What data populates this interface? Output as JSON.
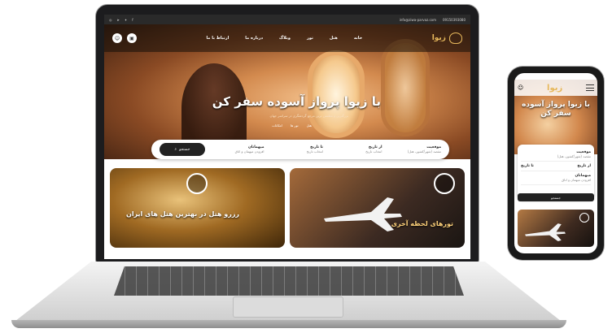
{
  "laptop": {
    "topbar": {
      "social_icons": [
        "instagram-icon",
        "telegram-icon",
        "twitter-icon",
        "facebook-icon"
      ],
      "email": "info@ziwa-parvaz.com",
      "phone": "09150393080"
    },
    "nav": {
      "logo_text": "زیوا",
      "menu": [
        "خانه",
        "هتل",
        "تور",
        "وبلاگ",
        "درباره ما",
        "ارتباط با ما"
      ]
    },
    "hero": {
      "title": "با زیوا پرواز آسوده سفر کن",
      "subtitle": "بزرگترین و مطمئن ترین مرجع گردشگری در سراسر جهان",
      "tabs": [
        "هتل",
        "تور ها",
        "امکانات"
      ]
    },
    "search": {
      "location_label": "موقعیت",
      "location_placeholder": "مقصد (شهر/کشور، هتل)",
      "from_label": "از تاریخ",
      "from_placeholder": "انتخاب تاریخ",
      "to_label": "تا تاریخ",
      "to_placeholder": "انتخاب تاریخ",
      "guests_label": "میهمانان",
      "guests_value": "افزودن میهمان و اتاق",
      "button": "جستجو"
    },
    "cards": {
      "hotel_caption": "رزرو هتل در بهترین هتل های ایران",
      "tour_caption": "تورهای لحظه آخری"
    }
  },
  "phone": {
    "title": "با زیوا پرواز آسوده سفر کن",
    "location_label": "موقعیت",
    "location_placeholder": "مقصد (شهر/کشور، هتل)",
    "from_label": "از تاریخ",
    "to_label": "تا تاریخ",
    "guests_label": "میهمانان",
    "guests_value": "افزودن میهمان و اتاق",
    "button": "جستجو"
  },
  "colors": {
    "accent": "#e6b85c",
    "dark": "#222222"
  }
}
